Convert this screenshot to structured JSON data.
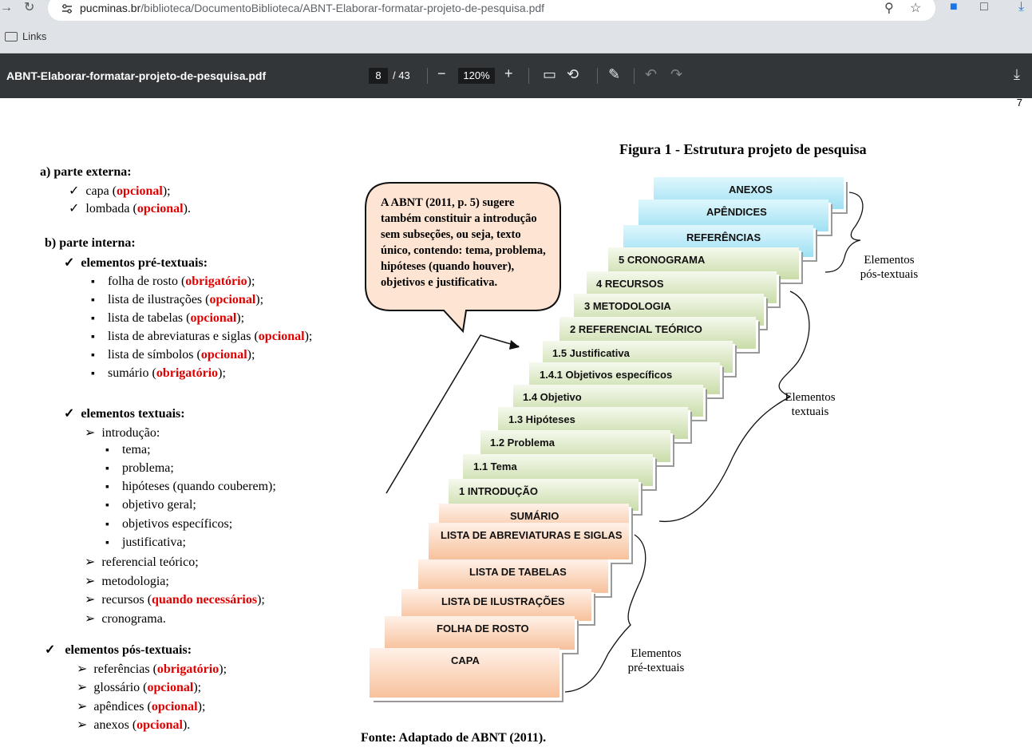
{
  "browser": {
    "url_host": "pucminas.br",
    "url_path": "/biblioteca/DocumentoBiblioteca/ABNT-Elaborar-formatar-projeto-de-pesquisa.pdf",
    "bookmark": "Links"
  },
  "pdf_toolbar": {
    "title": "ABNT-Elaborar-formatar-projeto-de-pesquisa.pdf",
    "page_current": "8",
    "page_total": "/ 43",
    "zoom": "120%",
    "minus": "−",
    "plus": "+"
  },
  "page": {
    "page_number": "7",
    "figure_title": "Figura 1 - Estrutura projeto de pesquisa",
    "source": "Fonte: Adaptado de ABNT (2011)."
  },
  "outline": {
    "a_heading": "a) parte externa:",
    "a_items": [
      {
        "pre": "capa (",
        "tag": "opcional",
        "post": ");"
      },
      {
        "pre": "lombada (",
        "tag": "opcional",
        "post": ")."
      }
    ],
    "b_heading": "b) parte interna:",
    "pre_heading": "elementos pré-textuais:",
    "pre_items": [
      {
        "pre": "folha de rosto (",
        "tag": "obrigatório",
        "post": ");"
      },
      {
        "pre": "lista de ilustrações (",
        "tag": "opcional",
        "post": ");"
      },
      {
        "pre": "lista de tabelas (",
        "tag": "opcional",
        "post": ");"
      },
      {
        "pre": "lista de abreviaturas e siglas (",
        "tag": "opcional",
        "post": ");"
      },
      {
        "pre": "lista de símbolos (",
        "tag": "opcional",
        "post": ");"
      },
      {
        "pre": "sumário (",
        "tag": "obrigatório",
        "post": ");"
      }
    ],
    "text_heading": "elementos textuais:",
    "intro": "introdução:",
    "intro_items": [
      "tema;",
      "problema;",
      "hipóteses (quando couberem);",
      "objetivo geral;",
      "objetivos específicos;",
      "justificativa;"
    ],
    "text_items": [
      {
        "pre": "referencial teórico;",
        "tag": "",
        "post": ""
      },
      {
        "pre": "metodologia;",
        "tag": "",
        "post": ""
      },
      {
        "pre": "recursos (",
        "tag": "quando necessários",
        "post": ");"
      },
      {
        "pre": "cronograma.",
        "tag": "",
        "post": ""
      }
    ],
    "post_heading": "elementos pós-textuais:",
    "post_items": [
      {
        "pre": "referências (",
        "tag": "obrigatório",
        "post": ");"
      },
      {
        "pre": "glossário (",
        "tag": "opcional",
        "post": ");"
      },
      {
        "pre": "apêndices (",
        "tag": "opcional",
        "post": ");"
      },
      {
        "pre": "anexos (",
        "tag": "opcional",
        "post": ")."
      }
    ]
  },
  "figure": {
    "bubble": "A ABNT (2011, p. 5) sugere também constituir a introdução sem subseções, ou seja, texto único, contendo: tema, problema, hipóteses (quando houver), objetivos e justificativa.",
    "steps": [
      {
        "label": "ANEXOS",
        "group": "post"
      },
      {
        "label": "APÊNDICES",
        "group": "post"
      },
      {
        "label": "REFERÊNCIAS",
        "group": "post"
      },
      {
        "label": "5 CRONOGRAMA",
        "group": "text"
      },
      {
        "label": "4 RECURSOS",
        "group": "text"
      },
      {
        "label": "3 METODOLOGIA",
        "group": "text"
      },
      {
        "label": "2 REFERENCIAL TEÓRICO",
        "group": "text"
      },
      {
        "label": "1.5 Justificativa",
        "group": "text"
      },
      {
        "label": "1.4.1 Objetivos específicos",
        "group": "text"
      },
      {
        "label": "1.4 Objetivo",
        "group": "text"
      },
      {
        "label": "1.3 Hipóteses",
        "group": "text"
      },
      {
        "label": "1.2 Problema",
        "group": "text"
      },
      {
        "label": "1.1 Tema",
        "group": "text"
      },
      {
        "label": "1 INTRODUÇÃO",
        "group": "text"
      },
      {
        "label": "SUMÁRIO",
        "group": "pre"
      },
      {
        "label": "LISTA DE ABREVIATURAS E SIGLAS",
        "group": "pre"
      },
      {
        "label": "LISTA DE TABELAS",
        "group": "pre"
      },
      {
        "label": "LISTA DE ILUSTRAÇÕES",
        "group": "pre"
      },
      {
        "label": "FOLHA DE ROSTO",
        "group": "pre"
      },
      {
        "label": "CAPA",
        "group": "pre"
      }
    ],
    "label_post": [
      "Elementos",
      "pós-textuais"
    ],
    "label_text": [
      "Elementos",
      "textuais"
    ],
    "label_pre": [
      "Elementos",
      "pré-textuais"
    ]
  },
  "colors": {
    "red": "#e00000",
    "toolbar": "#323639",
    "post": "#9fe0f3",
    "text": "#c9dca8",
    "pre": "#f7c19c"
  }
}
